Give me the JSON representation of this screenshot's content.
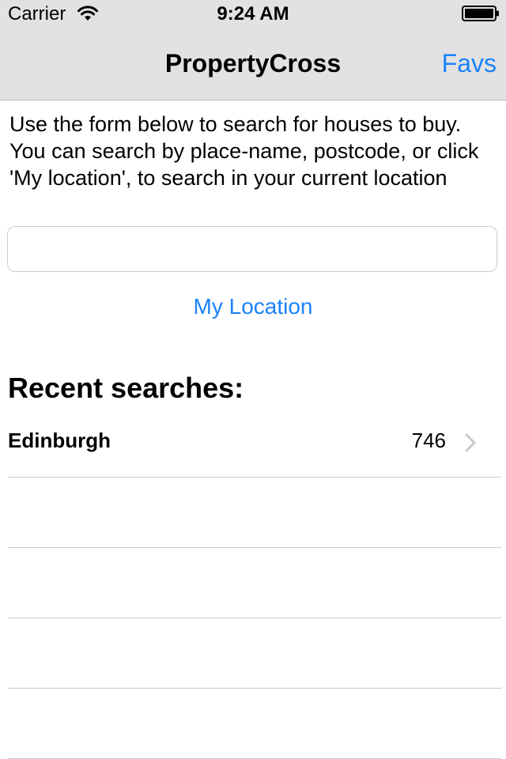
{
  "status_bar": {
    "carrier": "Carrier",
    "time": "9:24 AM",
    "icons": [
      "wifi-icon",
      "battery-icon"
    ]
  },
  "nav": {
    "title": "PropertyCross",
    "favs_label": "Favs"
  },
  "intro_text": "Use the form below to search for houses to buy. You can search by place-name, postcode, or click 'My location', to search in your current location",
  "search": {
    "value": "",
    "placeholder": ""
  },
  "my_location_label": "My Location",
  "recent": {
    "heading": "Recent searches:",
    "items": [
      {
        "place": "Edinburgh",
        "count": "746"
      }
    ]
  },
  "colors": {
    "accent": "#1a82fb",
    "nav_background": "#e2e2e2",
    "separator": "#c8c7cc"
  }
}
